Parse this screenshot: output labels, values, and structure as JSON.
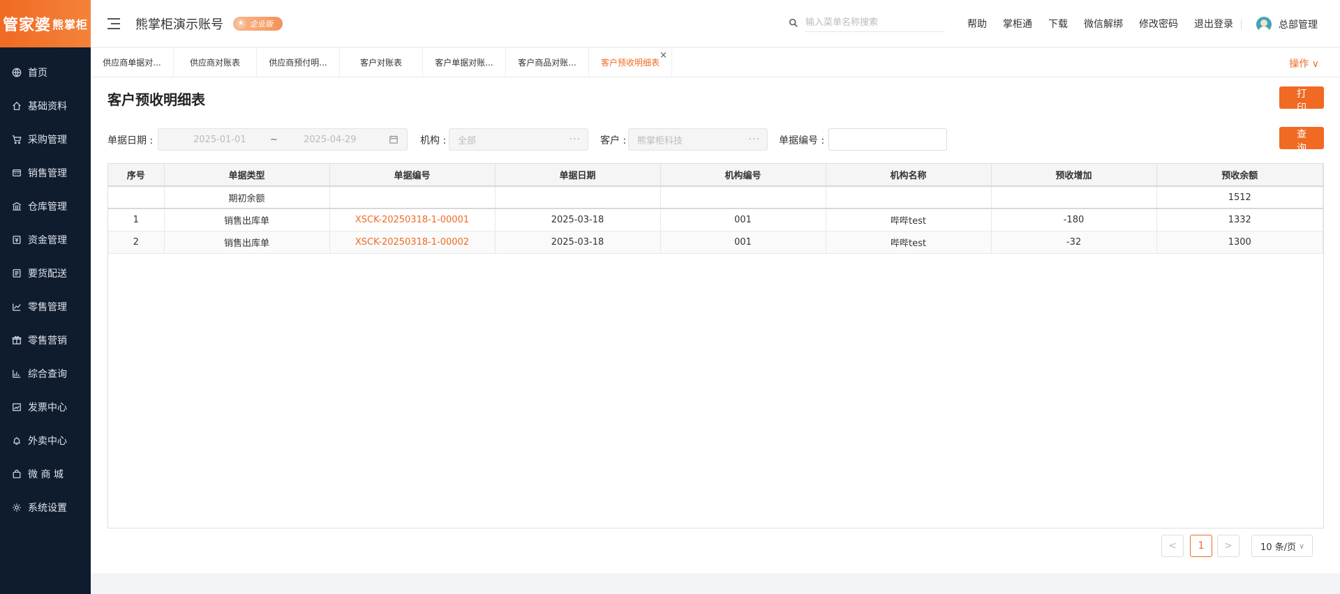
{
  "logo": {
    "main": "管家婆",
    "sub": "熊掌柜"
  },
  "sidebar": {
    "items": [
      {
        "label": "首页",
        "icon": "globe-icon"
      },
      {
        "label": "基础资料",
        "icon": "home-icon"
      },
      {
        "label": "采购管理",
        "icon": "cart-icon"
      },
      {
        "label": "销售管理",
        "icon": "sales-icon"
      },
      {
        "label": "仓库管理",
        "icon": "warehouse-icon"
      },
      {
        "label": "资金管理",
        "icon": "money-icon"
      },
      {
        "label": "要货配送",
        "icon": "list-icon"
      },
      {
        "label": "零售管理",
        "icon": "chart-icon"
      },
      {
        "label": "零售营销",
        "icon": "gift-icon"
      },
      {
        "label": "综合查询",
        "icon": "bar-chart-icon"
      },
      {
        "label": "发票中心",
        "icon": "trend-icon"
      },
      {
        "label": "外卖中心",
        "icon": "alarm-icon"
      },
      {
        "label": "微 商 城",
        "icon": "bag-icon"
      },
      {
        "label": "系统设置",
        "icon": "gear-icon"
      }
    ]
  },
  "header": {
    "account_title": "熊掌柜演示账号",
    "edition_badge": "企业版",
    "search_placeholder": "输入菜单名称搜索",
    "links": [
      "帮助",
      "掌柜通",
      "下载",
      "微信解绑",
      "修改密码",
      "退出登录"
    ],
    "user_name": "总部管理"
  },
  "tabs": {
    "items": [
      {
        "label": "供应商单据对...",
        "active": false
      },
      {
        "label": "供应商对账表",
        "active": false
      },
      {
        "label": "供应商预付明...",
        "active": false
      },
      {
        "label": "客户对账表",
        "active": false
      },
      {
        "label": "客户单据对账...",
        "active": false
      },
      {
        "label": "客户商品对账...",
        "active": false
      },
      {
        "label": "客户预收明细表",
        "active": true
      }
    ],
    "close_glyph": "×",
    "ops_label": "操作 ∨"
  },
  "page": {
    "title": "客户预收明细表",
    "print_label": "打印",
    "query_label": "查询"
  },
  "filters": {
    "date_label": "单据日期 :",
    "date_start": "2025-01-01",
    "date_sep": "~",
    "date_end": "2025-04-29",
    "org_label": "机构 :",
    "org_value": "全部",
    "customer_label": "客户 :",
    "customer_value": "熊掌柜科技",
    "doc_no_label": "单据编号 :",
    "doc_no_value": "",
    "dots": "···"
  },
  "table": {
    "columns": [
      "序号",
      "单据类型",
      "单据编号",
      "单据日期",
      "机构编号",
      "机构名称",
      "预收增加",
      "预收余额"
    ],
    "opening_row": {
      "type": "期初余额",
      "balance": "1512"
    },
    "rows": [
      {
        "seq": "1",
        "type": "销售出库单",
        "doc_no": "XSCK-20250318-1-00001",
        "date": "2025-03-18",
        "org_code": "001",
        "org_name": "哔哔test",
        "increase": "-180",
        "balance": "1332"
      },
      {
        "seq": "2",
        "type": "销售出库单",
        "doc_no": "XSCK-20250318-1-00002",
        "date": "2025-03-18",
        "org_code": "001",
        "org_name": "哔哔test",
        "increase": "-32",
        "balance": "1300"
      }
    ]
  },
  "pagination": {
    "prev": "<",
    "current": "1",
    "next": ">",
    "page_size": "10 条/页"
  },
  "colors": {
    "accent": "#f06a23",
    "sidebar_bg": "#0f1c2e"
  }
}
